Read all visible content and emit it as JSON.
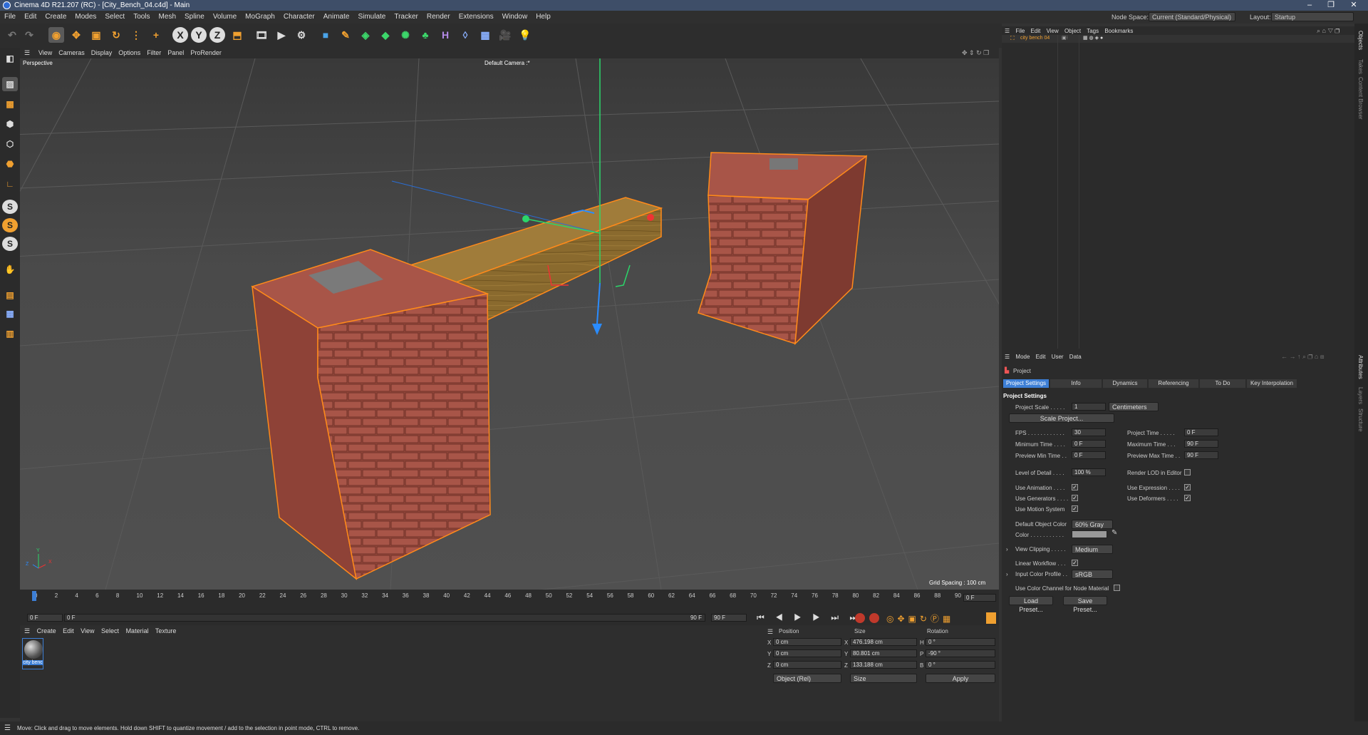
{
  "window": {
    "title": "Cinema 4D R21.207 (RC) - [City_Bench_04.c4d] - Main"
  },
  "menu": [
    "File",
    "Edit",
    "Create",
    "Modes",
    "Select",
    "Tools",
    "Mesh",
    "Spline",
    "Volume",
    "MoGraph",
    "Character",
    "Animate",
    "Simulate",
    "Tracker",
    "Render",
    "Extensions",
    "Window",
    "Help"
  ],
  "node_space": {
    "label": "Node Space:",
    "value": "Current (Standard/Physical)"
  },
  "layout": {
    "label": "Layout:",
    "value": "Startup"
  },
  "toolbar_axes": [
    "X",
    "Y",
    "Z"
  ],
  "viewport": {
    "menu": [
      "View",
      "Cameras",
      "Display",
      "Options",
      "Filter",
      "Panel",
      "ProRender"
    ],
    "view_name": "Perspective",
    "camera": "Default Camera :*",
    "grid_spacing": "Grid Spacing : 100 cm",
    "axis": {
      "x": "X",
      "y": "Y",
      "z": "Z"
    }
  },
  "timeline": {
    "ticks": [
      "0",
      "2",
      "4",
      "6",
      "8",
      "10",
      "12",
      "14",
      "16",
      "18",
      "20",
      "22",
      "24",
      "26",
      "28",
      "30",
      "32",
      "34",
      "36",
      "38",
      "40",
      "42",
      "44",
      "46",
      "48",
      "50",
      "52",
      "54",
      "56",
      "58",
      "60",
      "62",
      "64",
      "66",
      "68",
      "70",
      "72",
      "74",
      "76",
      "78",
      "80",
      "82",
      "84",
      "86",
      "88",
      "90"
    ],
    "current_frame": "0 F",
    "start": "0 F",
    "range_start": "0 F",
    "range_end": "90 F",
    "end": "90 F"
  },
  "material_panel": {
    "menu": [
      "Create",
      "Edit",
      "View",
      "Select",
      "Material",
      "Texture"
    ],
    "materials": [
      {
        "name": "city benc"
      }
    ]
  },
  "coordinates": {
    "headers": [
      "Position",
      "Size",
      "Rotation"
    ],
    "rows": [
      {
        "axis": "X",
        "pos": "0 cm",
        "size_axis": "X",
        "size": "476.198 cm",
        "rot_axis": "H",
        "rot": "0 °"
      },
      {
        "axis": "Y",
        "pos": "0 cm",
        "size_axis": "Y",
        "size": "80.801 cm",
        "rot_axis": "P",
        "rot": "-90 °"
      },
      {
        "axis": "Z",
        "pos": "0 cm",
        "size_axis": "Z",
        "size": "133.188 cm",
        "rot_axis": "B",
        "rot": "0 °"
      }
    ],
    "mode": "Object (Rel)",
    "size_mode": "Size",
    "apply": "Apply"
  },
  "objects_panel": {
    "menu": [
      "File",
      "Edit",
      "View",
      "Object",
      "Tags",
      "Bookmarks"
    ],
    "items": [
      {
        "name": "city bench 04"
      }
    ]
  },
  "attributes_panel": {
    "menu": [
      "Mode",
      "Edit",
      "User Data"
    ],
    "object": "Project",
    "tabs": [
      "Project Settings",
      "Info",
      "Dynamics",
      "Referencing",
      "To Do",
      "Key Interpolation"
    ],
    "section": "Project Settings",
    "project_scale": {
      "label": "Project Scale . . . . .",
      "value": "1",
      "unit": "Centimeters"
    },
    "scale_button": "Scale Project...",
    "fps": {
      "label": "FPS . . . . . . . . . . . .",
      "value": "30"
    },
    "project_time": {
      "label": "Project Time . . . . .",
      "value": "0 F"
    },
    "min_time": {
      "label": "Minimum Time . . . .",
      "value": "0 F"
    },
    "max_time": {
      "label": "Maximum Time . . .",
      "value": "90 F"
    },
    "prev_min": {
      "label": "Preview Min Time . .",
      "value": "0 F"
    },
    "prev_max": {
      "label": "Preview Max Time . .",
      "value": "90 F"
    },
    "lod": {
      "label": "Level of Detail . . . .",
      "value": "100 %"
    },
    "render_lod": {
      "label": "Render LOD in Editor",
      "checked": false
    },
    "use_animation": {
      "label": "Use Animation . . . .",
      "checked": true
    },
    "use_expression": {
      "label": "Use Expression . . . .",
      "checked": true
    },
    "use_generators": {
      "label": "Use Generators . . . .",
      "checked": true
    },
    "use_deformers": {
      "label": "Use Deformers . . . .",
      "checked": true
    },
    "use_motion": {
      "label": "Use Motion System",
      "checked": true
    },
    "default_color": {
      "label": "Default Object Color",
      "value": "60% Gray"
    },
    "color": {
      "label": "Color . . . . . . . . . . .",
      "swatch": "#999999"
    },
    "view_clipping": {
      "label": "View Clipping . . . . .",
      "value": "Medium"
    },
    "linear_workflow": {
      "label": "Linear Workflow . . .",
      "checked": true
    },
    "input_profile": {
      "label": "Input Color Profile . .",
      "value": "sRGB"
    },
    "use_color_channel": {
      "label": "Use Color Channel for Node Material",
      "checked": false
    },
    "load_preset": "Load Preset...",
    "save_preset": "Save Preset..."
  },
  "right_strip": [
    "Objects",
    "Takes",
    "Content Browser",
    "Attributes",
    "Layers",
    "Structure"
  ],
  "status": "Move: Click and drag to move elements. Hold down SHIFT to quantize movement / add to the selection in point mode, CTRL to remove.",
  "colors": {
    "accent": "#f0a030",
    "selection": "#ff8a1a",
    "tab_active": "#3d7fd6"
  }
}
